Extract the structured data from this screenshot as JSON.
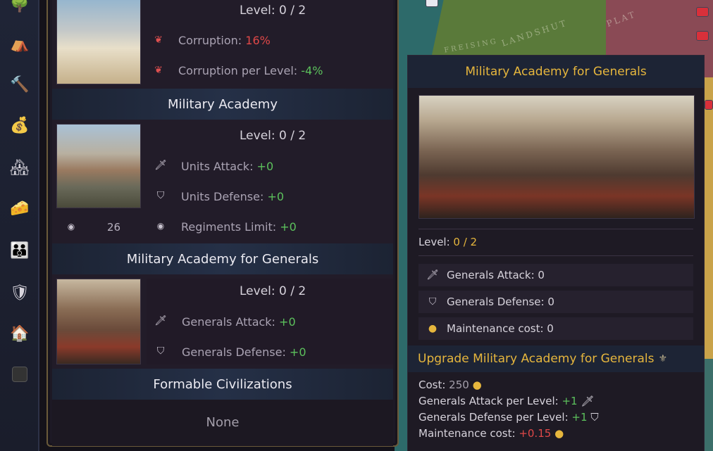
{
  "map": {
    "labels": [
      "LANDSHUT",
      "PLAT",
      "FREISING"
    ]
  },
  "iconbar": {
    "icons": [
      "tree-icon",
      "tent-icon",
      "hammer-icon",
      "merchant-icon",
      "city-icon",
      "cheese-icon",
      "family-icon",
      "knight-icon",
      "house-icon",
      "blank-icon"
    ]
  },
  "court": {
    "level": "Level: 0 / 2",
    "corruption_label": "Corruption: ",
    "corruption_value": "16%",
    "corruption_per_level_label": "Corruption per Level: ",
    "corruption_per_level_value": "-4%"
  },
  "military_academy": {
    "header": "Military Academy",
    "level": "Level: 0 / 2",
    "units_attack_label": "Units Attack: ",
    "units_attack_value": "+0",
    "units_defense_label": "Units Defense: ",
    "units_defense_value": "+0",
    "regiments_label": "Regiments Limit: ",
    "regiments_value": "+0",
    "regiments_count": "26"
  },
  "generals_academy": {
    "header": "Military Academy for Generals",
    "level": "Level: 0 / 2",
    "attack_label": "Generals Attack: ",
    "attack_value": "+0",
    "defense_label": "Generals Defense: ",
    "defense_value": "+0"
  },
  "formable": {
    "header": "Formable Civilizations",
    "value": "None"
  },
  "tooltip": {
    "title": "Military Academy for Generals",
    "level_label": "Level: ",
    "level_value": "0 / 2",
    "stats": [
      {
        "icon": "sword-icon",
        "text": "Generals Attack: 0"
      },
      {
        "icon": "shield-icon",
        "text": "Generals Defense: 0"
      },
      {
        "icon": "coins-icon",
        "text": "Maintenance cost: 0"
      }
    ],
    "upgrade_title": "Upgrade Military Academy for Generals",
    "cost_label": "Cost: ",
    "cost_value": "250",
    "attack_per_level_label": "Generals Attack per Level: ",
    "attack_per_level_value": "+1",
    "defense_per_level_label": "Generals Defense per Level: ",
    "defense_per_level_value": "+1",
    "maintenance_label": "Maintenance cost: ",
    "maintenance_value": "+0.15"
  }
}
